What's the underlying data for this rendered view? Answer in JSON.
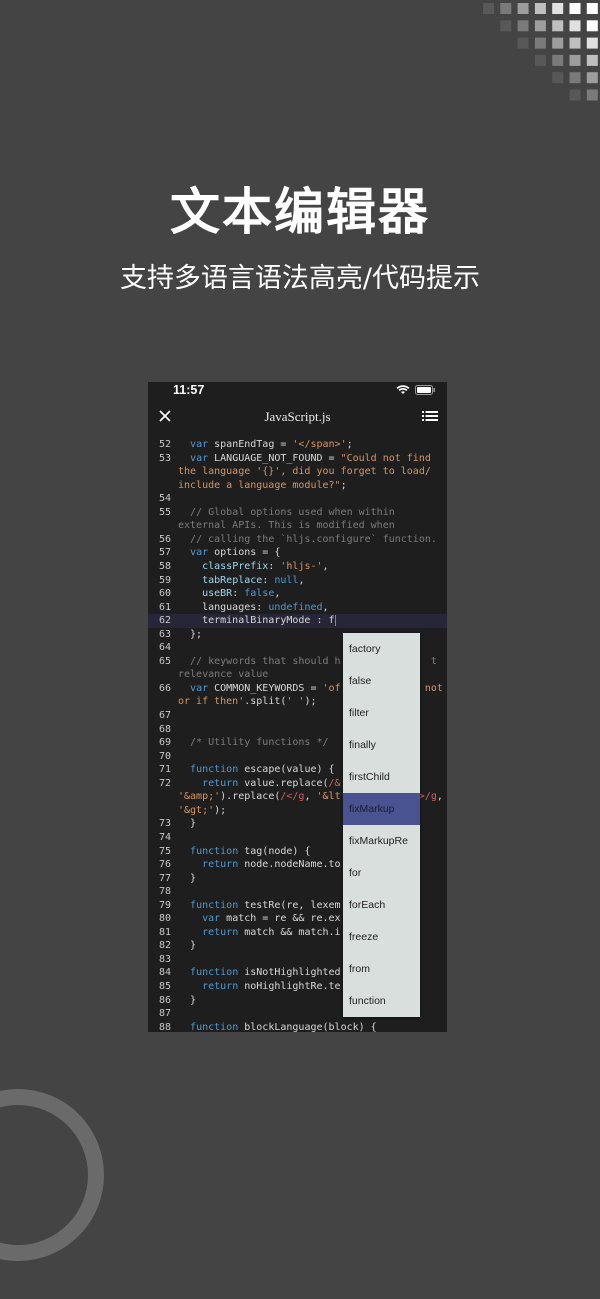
{
  "title": "文本编辑器",
  "subtitle": "支持多语言语法高亮/代码提示",
  "status": {
    "time": "11:57"
  },
  "editor": {
    "file_title": "JavaScript.js"
  },
  "rows": [
    {
      "n": "52",
      "t": [
        [
          "d",
          "  "
        ],
        [
          "k",
          "var"
        ],
        [
          "d",
          " spanEndTag = "
        ],
        [
          "s",
          "'</span>'"
        ],
        [
          "d",
          ";"
        ]
      ]
    },
    {
      "n": "53",
      "t": [
        [
          "d",
          "  "
        ],
        [
          "k",
          "var"
        ],
        [
          "d",
          " LANGUAGE_NOT_FOUND = "
        ],
        [
          "s",
          "\"Could not find"
        ]
      ]
    },
    {
      "n": "",
      "t": [
        [
          "s",
          "the language '{}', did you forget to load/"
        ]
      ]
    },
    {
      "n": "",
      "t": [
        [
          "s",
          "include a language module?\""
        ],
        [
          "d",
          ";"
        ]
      ]
    },
    {
      "n": "54",
      "t": []
    },
    {
      "n": "55",
      "t": [
        [
          "d",
          "  "
        ],
        [
          "c",
          "// Global options used when within"
        ]
      ]
    },
    {
      "n": "",
      "t": [
        [
          "c",
          "external APIs. This is modified when"
        ]
      ]
    },
    {
      "n": "56",
      "t": [
        [
          "d",
          "  "
        ],
        [
          "c",
          "// calling the `hljs.configure` function."
        ]
      ]
    },
    {
      "n": "57",
      "t": [
        [
          "d",
          "  "
        ],
        [
          "k",
          "var"
        ],
        [
          "d",
          " options = {"
        ]
      ]
    },
    {
      "n": "58",
      "t": [
        [
          "d",
          "    "
        ],
        [
          "p",
          "classPrefix"
        ],
        [
          "d",
          ": "
        ],
        [
          "s",
          "'hljs-'"
        ],
        [
          "d",
          ","
        ]
      ]
    },
    {
      "n": "59",
      "t": [
        [
          "d",
          "    "
        ],
        [
          "p",
          "tabReplace"
        ],
        [
          "d",
          ": "
        ],
        [
          "l",
          "null"
        ],
        [
          "d",
          ","
        ]
      ]
    },
    {
      "n": "60",
      "t": [
        [
          "d",
          "    "
        ],
        [
          "p",
          "useBR"
        ],
        [
          "d",
          ": "
        ],
        [
          "l",
          "false"
        ],
        [
          "d",
          ","
        ]
      ]
    },
    {
      "n": "61",
      "t": [
        [
          "d",
          "    languages: "
        ],
        [
          "l",
          "undefined"
        ],
        [
          "d",
          ","
        ]
      ]
    },
    {
      "n": "62",
      "cur": true,
      "t": [
        [
          "d",
          "    terminalBinaryMode : f"
        ]
      ]
    },
    {
      "n": "63",
      "t": [
        [
          "d",
          "  };"
        ]
      ]
    },
    {
      "n": "64",
      "t": []
    },
    {
      "n": "65",
      "t": [
        [
          "d",
          "  "
        ],
        [
          "c",
          "// keywords that should h"
        ]
      ],
      "r": [
        [
          "c",
          "t"
        ]
      ],
      "rx": 42
    },
    {
      "n": "",
      "t": [
        [
          "c",
          "relevance value"
        ]
      ]
    },
    {
      "n": "66",
      "t": [
        [
          "d",
          "  "
        ],
        [
          "k",
          "var"
        ],
        [
          "d",
          " COMMON_KEYWORDS = "
        ],
        [
          "s",
          "'of"
        ]
      ],
      "r": [
        [
          "s",
          "not"
        ]
      ],
      "rx": 41
    },
    {
      "n": "",
      "t": [
        [
          "s",
          "or if then'"
        ],
        [
          "d",
          ".split("
        ],
        [
          "s",
          "' '"
        ],
        [
          "d",
          ");"
        ]
      ]
    },
    {
      "n": "67",
      "t": []
    },
    {
      "n": "68",
      "t": []
    },
    {
      "n": "69",
      "t": [
        [
          "d",
          "  "
        ],
        [
          "c",
          "/* Utility functions */"
        ]
      ]
    },
    {
      "n": "70",
      "t": []
    },
    {
      "n": "71",
      "t": [
        [
          "d",
          "  "
        ],
        [
          "k",
          "function"
        ],
        [
          "d",
          " escape(value) {"
        ]
      ]
    },
    {
      "n": "72",
      "t": [
        [
          "d",
          "    "
        ],
        [
          "k",
          "return"
        ],
        [
          "d",
          " value.replace("
        ],
        [
          "r",
          "/&"
        ]
      ]
    },
    {
      "n": "",
      "t": [
        [
          "s",
          "'&amp;'"
        ],
        [
          "d",
          ").replace("
        ],
        [
          "r",
          "/</g"
        ],
        [
          "d",
          ", "
        ],
        [
          "s",
          "'&lt"
        ]
      ],
      "r": [
        [
          "r",
          ">/g"
        ],
        [
          "d",
          ","
        ]
      ],
      "rx": 40
    },
    {
      "n": "",
      "t": [
        [
          "s",
          "'&gt;'"
        ],
        [
          "d",
          ");"
        ]
      ]
    },
    {
      "n": "73",
      "t": [
        [
          "d",
          "  }"
        ]
      ]
    },
    {
      "n": "74",
      "t": []
    },
    {
      "n": "75",
      "t": [
        [
          "d",
          "  "
        ],
        [
          "k",
          "function"
        ],
        [
          "d",
          " tag(node) {"
        ]
      ]
    },
    {
      "n": "76",
      "t": [
        [
          "d",
          "    "
        ],
        [
          "k",
          "return"
        ],
        [
          "d",
          " node.nodeName.to"
        ]
      ]
    },
    {
      "n": "77",
      "t": [
        [
          "d",
          "  }"
        ]
      ]
    },
    {
      "n": "78",
      "t": []
    },
    {
      "n": "79",
      "t": [
        [
          "d",
          "  "
        ],
        [
          "k",
          "function"
        ],
        [
          "d",
          " testRe(re, lexem"
        ]
      ]
    },
    {
      "n": "80",
      "t": [
        [
          "d",
          "    "
        ],
        [
          "k",
          "var"
        ],
        [
          "d",
          " match = re && re.ex"
        ]
      ]
    },
    {
      "n": "81",
      "t": [
        [
          "d",
          "    "
        ],
        [
          "k",
          "return"
        ],
        [
          "d",
          " match && match.i"
        ]
      ]
    },
    {
      "n": "82",
      "t": [
        [
          "d",
          "  }"
        ]
      ]
    },
    {
      "n": "83",
      "t": []
    },
    {
      "n": "84",
      "t": [
        [
          "d",
          "  "
        ],
        [
          "k",
          "function"
        ],
        [
          "d",
          " isNotHighlighted"
        ]
      ]
    },
    {
      "n": "85",
      "t": [
        [
          "d",
          "    "
        ],
        [
          "k",
          "return"
        ],
        [
          "d",
          " noHighlightRe.te"
        ]
      ]
    },
    {
      "n": "86",
      "t": [
        [
          "d",
          "  }"
        ]
      ]
    },
    {
      "n": "87",
      "t": []
    },
    {
      "n": "88",
      "t": [
        [
          "d",
          "  "
        ],
        [
          "k",
          "function"
        ],
        [
          "d",
          " blockLanguage(block) {"
        ]
      ]
    }
  ],
  "autocomplete": {
    "selected": "fixMarkup",
    "items": [
      "factory",
      "false",
      "filter",
      "finally",
      "firstChild",
      "fixMarkup",
      "fixMarkupRe",
      "for",
      "forEach",
      "freeze",
      "from",
      "function"
    ]
  },
  "colors": {
    "background": "#444444",
    "editor_bg": "#1e1e1e",
    "keyword": "#4c9ad6",
    "string": "#d7955f",
    "comment": "#7c7c7c",
    "selected_item": "#4a5391"
  }
}
